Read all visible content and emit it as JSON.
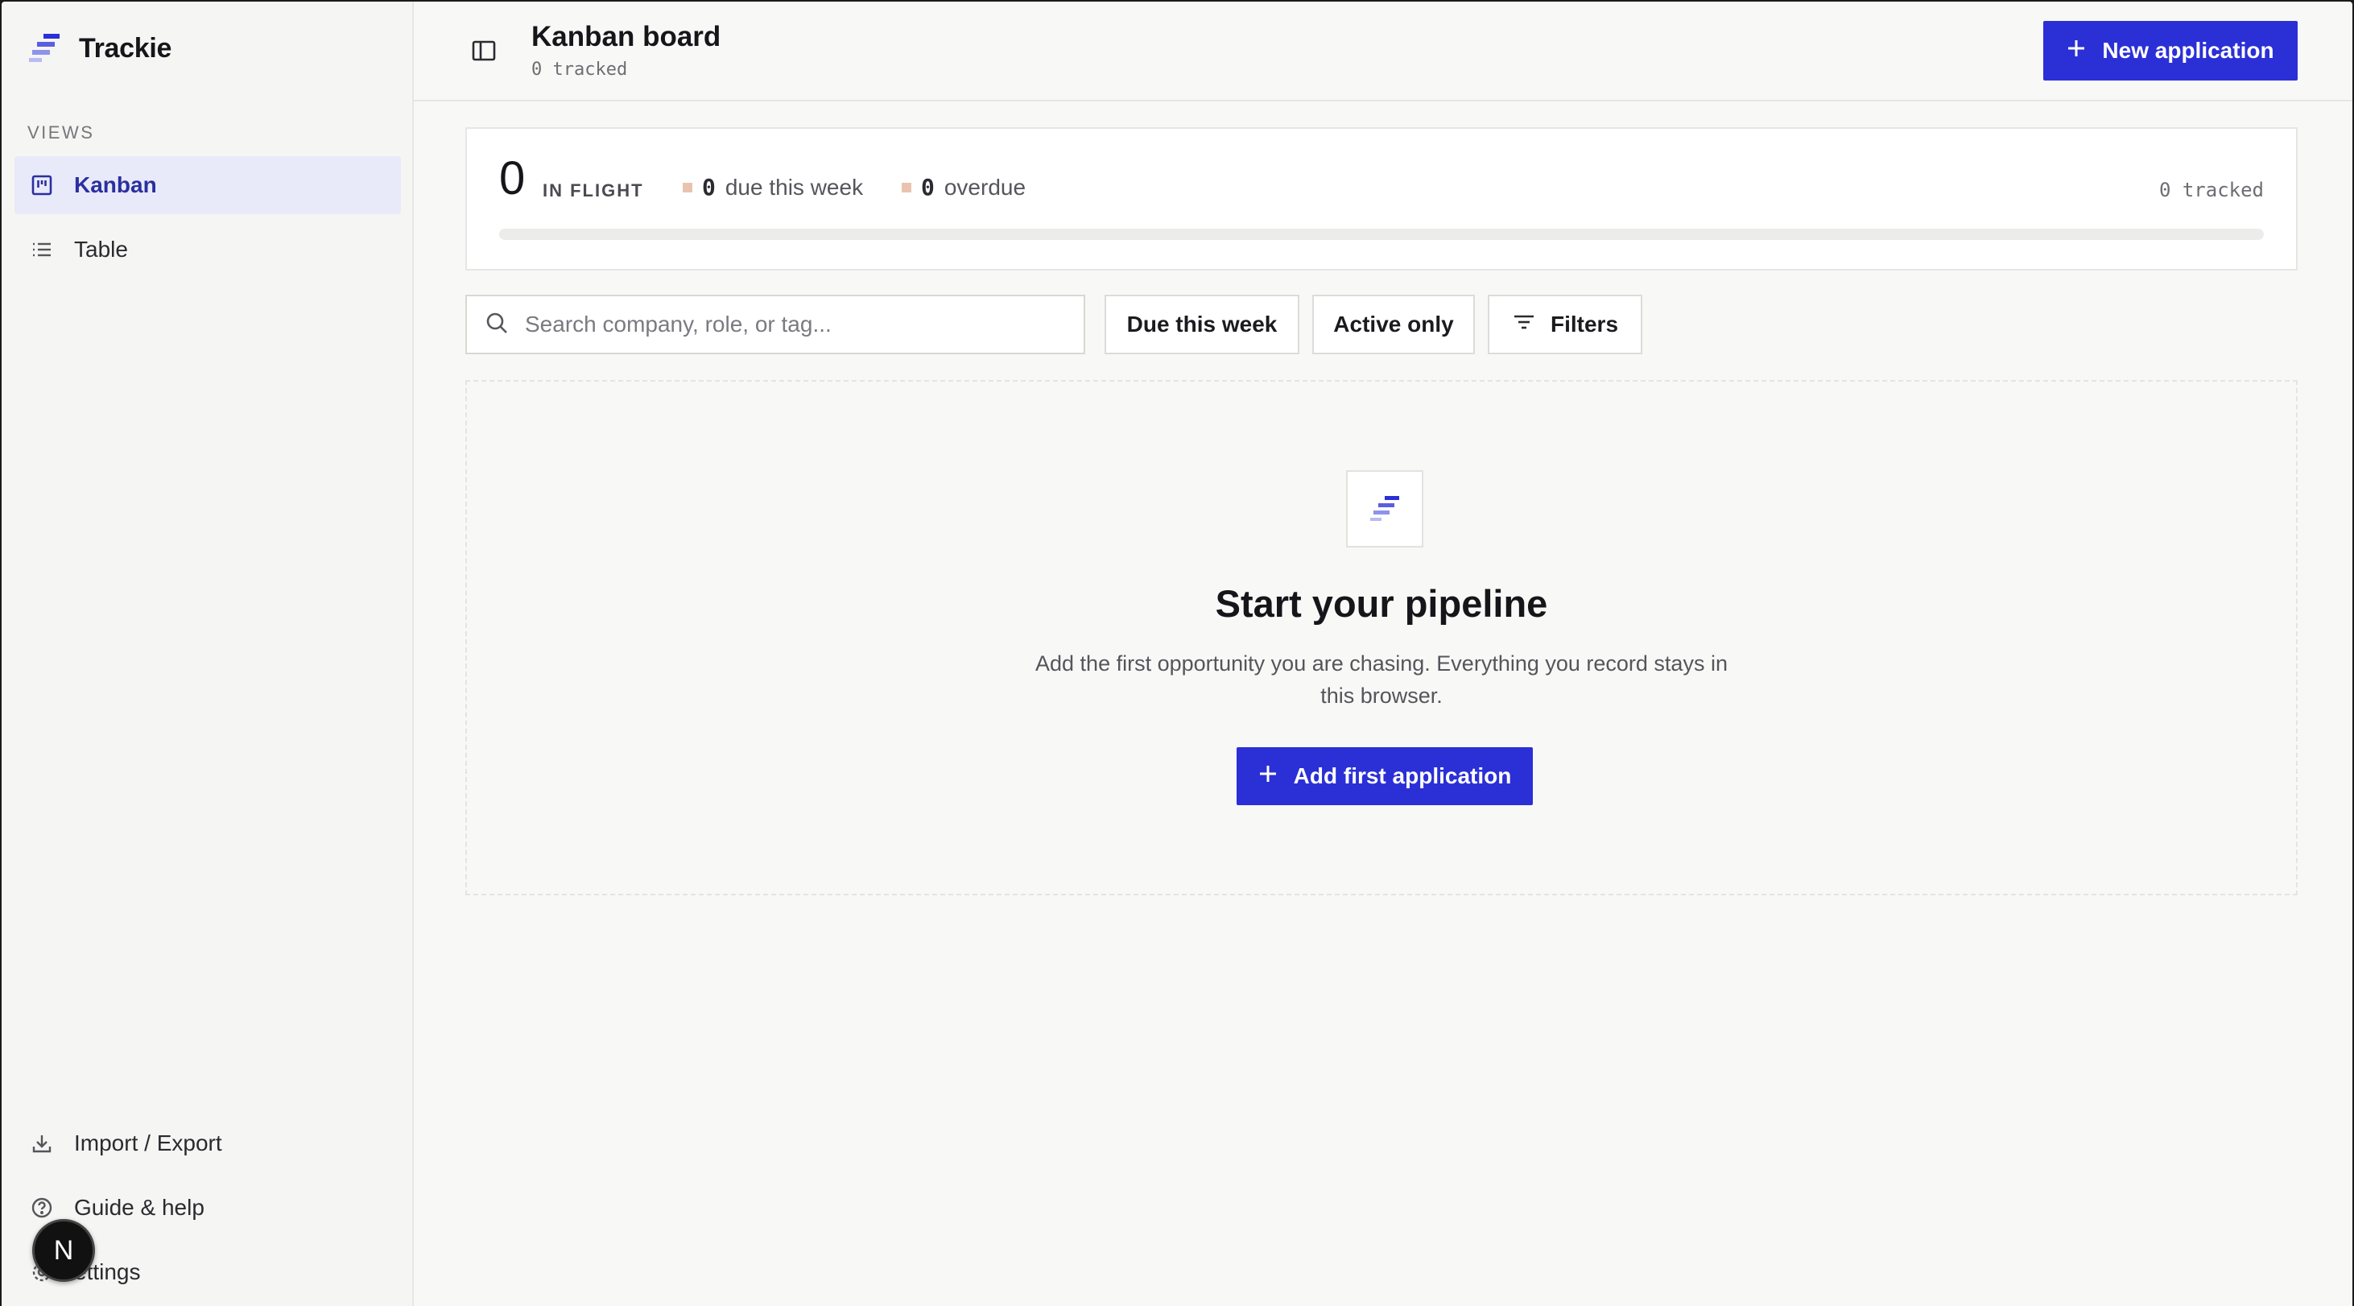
{
  "app": {
    "name": "Trackie",
    "brand_icon": "trackie-logo-icon"
  },
  "sidebar": {
    "section_label": "VIEWS",
    "items": [
      {
        "label": "Kanban",
        "icon": "kanban-icon",
        "active": true
      },
      {
        "label": "Table",
        "icon": "list-icon",
        "active": false
      }
    ],
    "bottom": [
      {
        "label": "Import / Export",
        "icon": "download-icon"
      },
      {
        "label": "Guide & help",
        "icon": "help-circle-icon"
      },
      {
        "label": "ettings",
        "icon": "gear-icon"
      }
    ],
    "avatar_letter": "N"
  },
  "header": {
    "title": "Kanban board",
    "subtitle": "0 tracked",
    "new_button": "New application"
  },
  "stats": {
    "in_flight_count": "0",
    "in_flight_label": "IN FLIGHT",
    "due_count": "0",
    "due_label": "due this week",
    "overdue_count": "0",
    "overdue_label": "overdue",
    "tracked": "0 tracked",
    "progress_fraction": 0,
    "dot_color": "#e9c3b0"
  },
  "toolbar": {
    "search_placeholder": "Search company, role, or tag...",
    "search_value": "",
    "due_this_week": "Due this week",
    "active_only": "Active only",
    "filters": "Filters"
  },
  "empty_state": {
    "title": "Start your pipeline",
    "description": "Add the first opportunity you are chasing. Everything you record stays in this browser.",
    "button": "Add first application"
  },
  "colors": {
    "accent": "#2b2fd6",
    "active_bg": "#e8eafa",
    "active_text": "#2b2f9e"
  }
}
